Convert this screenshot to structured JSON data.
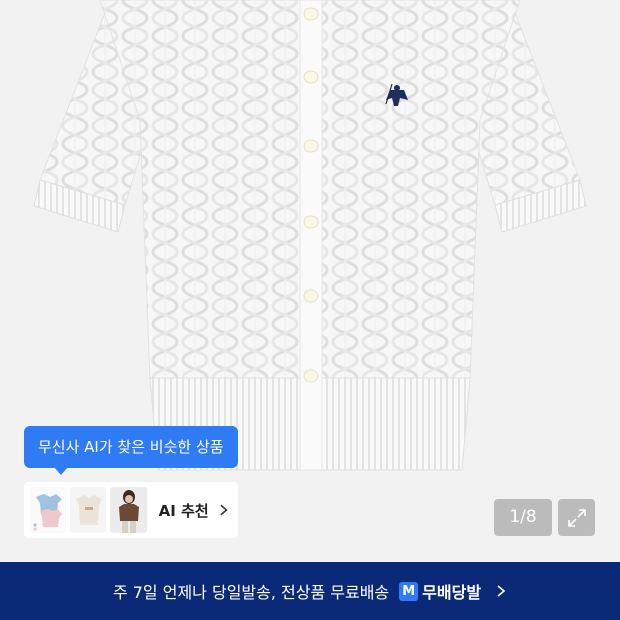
{
  "gallery": {
    "counter": "1/8"
  },
  "ai_similar": {
    "tooltip_text": "무신사 AI가 찾은 비슷한 상품",
    "button_label": "AI 추천",
    "thumbnails": [
      "light-blue-and-pink-tees",
      "beige-tee",
      "person-in-brown-top"
    ]
  },
  "promo": {
    "text": "주 7일 언제나 당일발송, 전상품 무료배송",
    "badge": "M",
    "brand": "무배당발"
  },
  "icons": [
    "expand-icon",
    "chevron-right-icon",
    "polo-logo"
  ],
  "colors": {
    "accent": "#2f7af5",
    "banner": "#0a2a78",
    "background": "#f2f2f2"
  }
}
